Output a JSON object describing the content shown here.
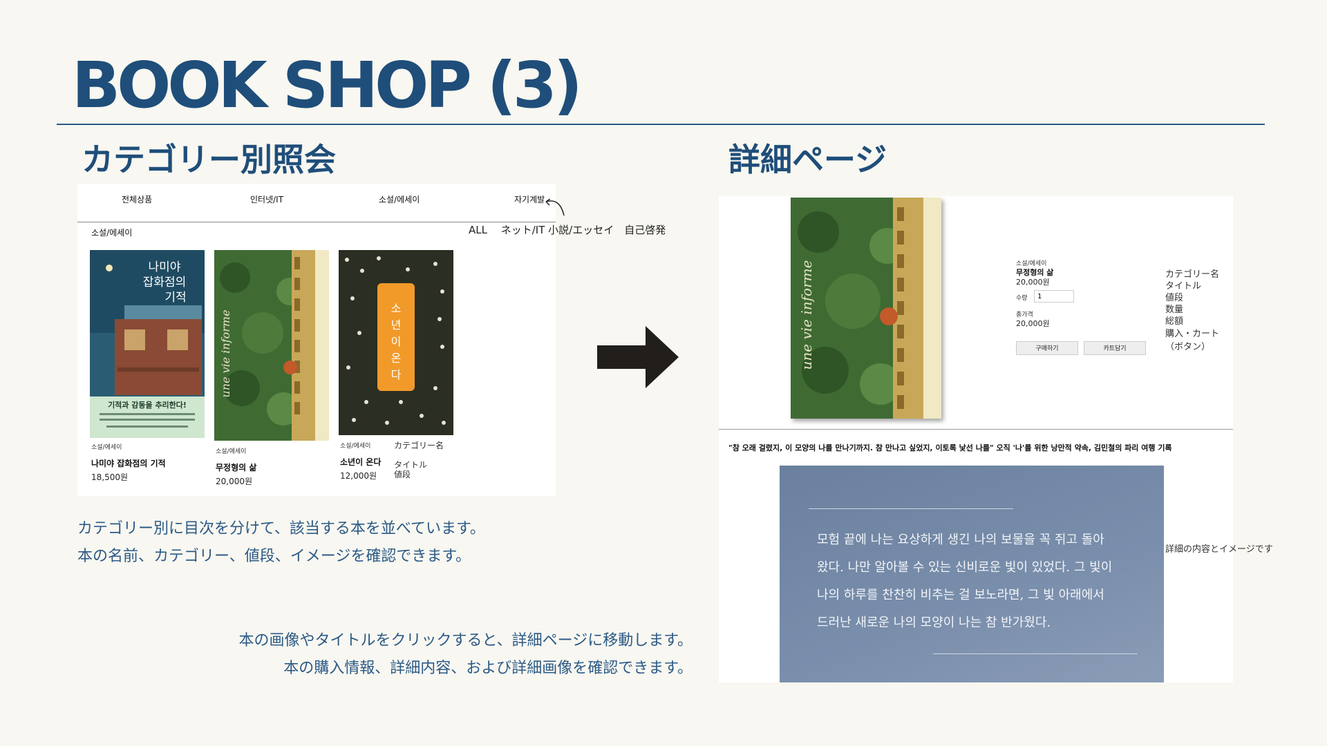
{
  "page_title": "BOOK SHOP (3)",
  "left_section": {
    "heading": "カテゴリー別照会",
    "tabs": [
      "전체상품",
      "인터넷/IT",
      "소설/에세이",
      "자기계발"
    ],
    "tab_translation": "ALL　 ネット/IT 小説/エッセイ　自己啓発",
    "breadcrumb": "소설/에세이",
    "books": [
      {
        "category": "소설/에세이",
        "title": "나미야 잡화점의 기적",
        "price": "18,500원",
        "cover_text": "나미야\n잡화점의\n기적",
        "banner": "기적과 감동을 추리한다!"
      },
      {
        "category": "소설/에세이",
        "title": "무정형의 삶",
        "price": "20,000원",
        "cover_text": "무정형의 삶"
      },
      {
        "category": "소설/에세이",
        "title": "소년이 온다",
        "price": "12,000원",
        "cover_text": "소년이 온다"
      }
    ],
    "annotations": {
      "category": "カテゴリー名",
      "title": "タイトル",
      "price": "値段"
    },
    "description": [
      "カテゴリー別に目次を分けて、該当する本を並べています。",
      "本の名前、カテゴリー、値段、イメージを確認できます。"
    ]
  },
  "bottom_description": [
    "本の画像やタイトルをクリックすると、詳細ページに移動します。",
    "本の購入情報、詳細内容、および詳細画像を確認できます。"
  ],
  "right_section": {
    "heading": "詳細ページ",
    "category": "소설/에세이",
    "title": "무정형의 삶",
    "price": "20,000원",
    "qty_label": "수량",
    "qty_value": "1",
    "total_label": "총가격",
    "total_value": "20,000원",
    "buy_button": "구매하기",
    "cart_button": "카트담기",
    "annotations": [
      "カテゴリー名",
      "タイトル",
      "値段",
      "数量",
      "総額",
      "購入・カート（ボタン）"
    ],
    "quote": "\"참 오래 걸렸지, 이 모양의 나를 만나기까지. 참 만나고 싶었지, 이토록 낯선 나를\" 오직 '나'를 위한 낭만적 약속, 김민철의 파리 여행 기록",
    "prose": [
      "모험 끝에 나는 요상하게 생긴 나의 보물을 꼭 쥐고 돌아",
      "왔다. 나만 알아볼 수 있는 신비로운 빛이 있었다. 그 빛이",
      "나의 하루를 찬찬히 비추는 걸 보노라면, 그 빛 아래에서",
      "드러난 새로운 나의 모양이 나는 참 반가웠다."
    ],
    "detail_note": "詳細の内容とイメージです"
  },
  "colors": {
    "accent": "#1f4e7a",
    "background": "#f8f7f1",
    "text_blue": "#2c5a86"
  }
}
